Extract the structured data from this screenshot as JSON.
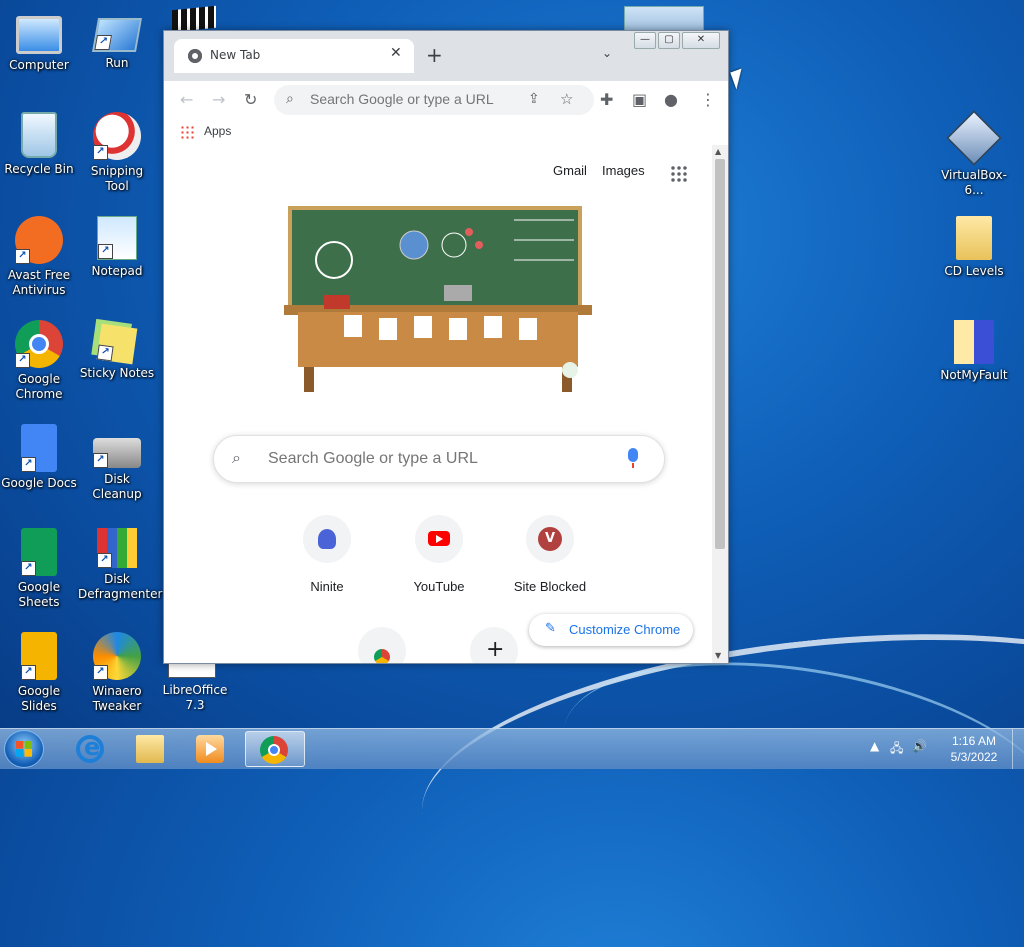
{
  "desktop": {
    "icons_left": [
      {
        "label": "Computer",
        "icon": "computer-icon",
        "shortcut": false
      },
      {
        "label": "Run",
        "icon": "run-icon",
        "shortcut": true
      },
      {
        "label": "Recycle Bin",
        "icon": "recycle-bin-icon",
        "shortcut": false
      },
      {
        "label": "Snipping Tool",
        "icon": "snipping-tool-icon",
        "shortcut": true
      },
      {
        "label": "Avast Free Antivirus",
        "icon": "avast-icon",
        "shortcut": true
      },
      {
        "label": "Notepad",
        "icon": "notepad-icon",
        "shortcut": true
      },
      {
        "label": "Google Chrome",
        "icon": "chrome-icon",
        "shortcut": true
      },
      {
        "label": "Sticky Notes",
        "icon": "sticky-notes-icon",
        "shortcut": true
      },
      {
        "label": "Google Docs",
        "icon": "google-docs-icon",
        "shortcut": true
      },
      {
        "label": "Disk Cleanup",
        "icon": "disk-cleanup-icon",
        "shortcut": true
      },
      {
        "label": "Google Sheets",
        "icon": "google-sheets-icon",
        "shortcut": true
      },
      {
        "label": "Disk Defragmenter",
        "icon": "disk-defragmenter-icon",
        "shortcut": true
      },
      {
        "label": "Google Slides",
        "icon": "google-slides-icon",
        "shortcut": true
      },
      {
        "label": "Winaero Tweaker",
        "icon": "winaero-icon",
        "shortcut": true
      },
      {
        "label": "LibreOffice 7.3",
        "icon": "libreoffice-icon",
        "shortcut": true
      }
    ],
    "icons_right": [
      {
        "label": "VirtualBox-6...",
        "icon": "virtualbox-icon"
      },
      {
        "label": "CD Levels",
        "icon": "folder-icon"
      },
      {
        "label": "NotMyFault",
        "icon": "notmyfault-icon"
      }
    ]
  },
  "browser": {
    "tab_title": "New Tab",
    "tab_close": "✕",
    "new_tab": "+",
    "tab_search": "⌄",
    "window_controls": {
      "minimize": "—",
      "maximize": "▢",
      "close": "✕"
    },
    "toolbar": {
      "back": "←",
      "forward": "→",
      "reload": "↻",
      "omnibox_placeholder": "Search Google or type a URL",
      "share": "⇪",
      "star": "☆",
      "extensions": "✚",
      "sidepanel": "▣",
      "profile": "●",
      "menu": "⋮"
    },
    "bookmarks": {
      "apps_label": "Apps"
    },
    "ntp": {
      "links": [
        "Gmail",
        "Images"
      ],
      "search_placeholder": "Search Google or type a URL",
      "shortcuts": [
        {
          "label": "Ninite",
          "icon": "ninite-icon"
        },
        {
          "label": "YouTube",
          "icon": "youtube-icon"
        },
        {
          "label": "Site Blocked",
          "icon": "site-blocked-icon",
          "badge": "V"
        }
      ],
      "customize_label": "Customize Chrome",
      "add_shortcut": "+"
    },
    "scroll_arrows": {
      "up": "▲",
      "down": "▼"
    }
  },
  "taskbar": {
    "pinned": [
      {
        "name": "internet-explorer",
        "icon": "internet-explorer-icon"
      },
      {
        "name": "file-explorer",
        "icon": "file-explorer-icon"
      },
      {
        "name": "media-player",
        "icon": "media-player-icon"
      },
      {
        "name": "google-chrome",
        "icon": "chrome-icon",
        "active": true
      }
    ],
    "tray": {
      "arrow": "▲",
      "network": "🖧",
      "volume": "🔊"
    },
    "clock": {
      "time": "1:16 AM",
      "date": "5/3/2022"
    }
  },
  "colors": {
    "accent": "#1a73e8",
    "youtube": "#ff0000",
    "badge": "#b0413e"
  }
}
